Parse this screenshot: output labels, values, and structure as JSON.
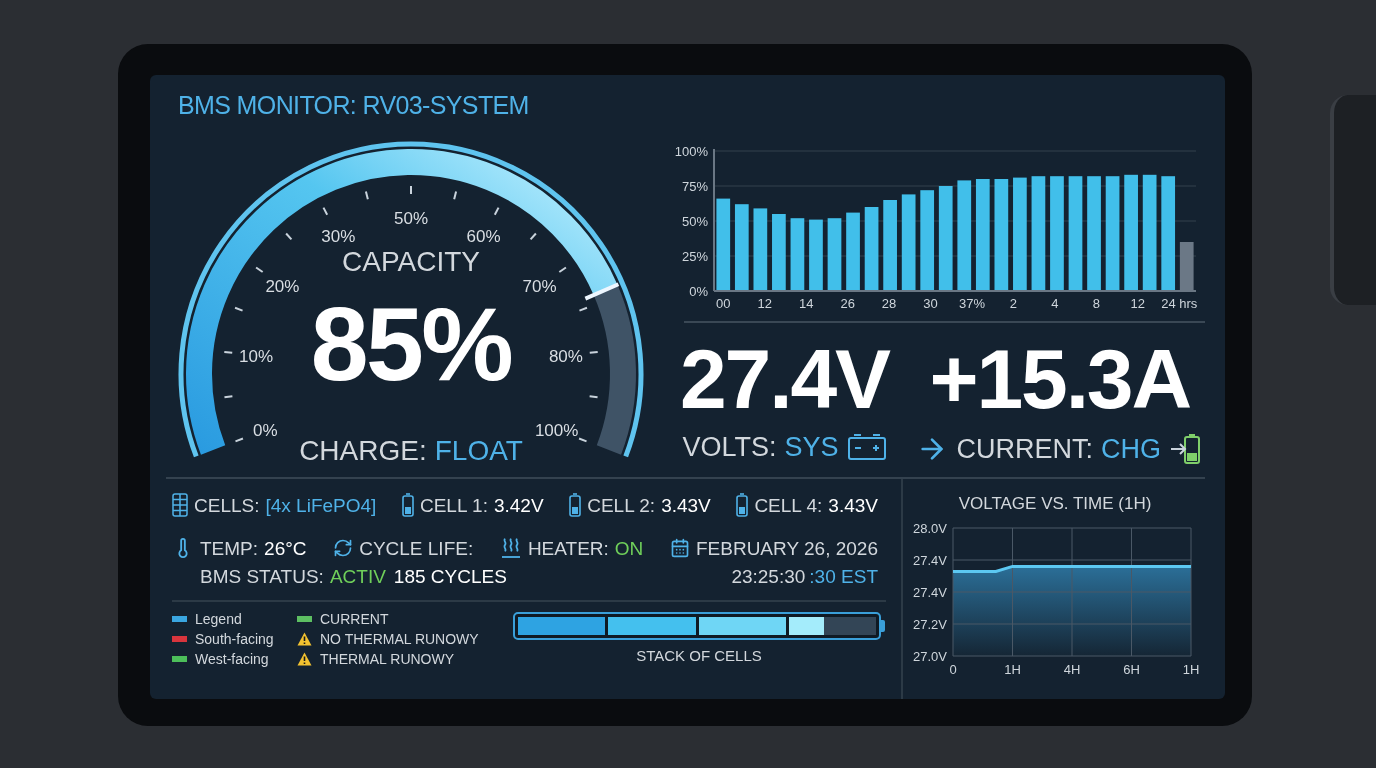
{
  "title": "BMS MONITOR: RV03-SYSTEM",
  "gauge": {
    "heading": "CAPACITY",
    "value": "85%",
    "ticks": [
      "0%",
      "10%",
      "20%",
      "30%",
      "50%",
      "60%",
      "70%",
      "80%",
      "100%"
    ],
    "status_label": "CHARGE:",
    "status_value": "FLOAT"
  },
  "history": {
    "chart_data": {
      "type": "bar",
      "stacked": true,
      "grid": true,
      "series": [
        {
          "color": "#41bfea",
          "values": [
            66,
            62,
            59,
            55,
            52,
            51,
            52,
            56,
            60,
            65,
            69,
            72,
            75,
            79,
            80,
            80,
            81,
            82,
            82,
            82,
            82,
            82,
            83,
            83,
            82,
            null
          ]
        },
        {
          "color": "#6b7886",
          "values": [
            null,
            null,
            null,
            null,
            null,
            null,
            null,
            null,
            null,
            null,
            null,
            null,
            null,
            null,
            null,
            null,
            null,
            null,
            null,
            null,
            null,
            null,
            null,
            null,
            null,
            35
          ]
        }
      ],
      "ylim": [
        0,
        100
      ],
      "yticks": [
        {
          "value": 0,
          "label": "0%"
        },
        {
          "value": 25,
          "label": "25%"
        },
        {
          "value": 50,
          "label": "50%"
        },
        {
          "value": 75,
          "label": "75%"
        },
        {
          "value": 100,
          "label": "100%"
        }
      ]
    },
    "axis_labels": [
      "00",
      "12",
      "14",
      "26",
      "28",
      "30",
      "37%",
      "2",
      "4",
      "8",
      "12",
      "24 hrs"
    ]
  },
  "readouts": [
    {
      "kind": "volts",
      "value": "27.4V",
      "label": "VOLTS:",
      "mode": "SYS"
    },
    {
      "kind": "current",
      "value": "+15.3A",
      "label": "CURRENT:",
      "mode": "CHG"
    }
  ],
  "cells_row": [
    {
      "kind": "pack",
      "label": "CELLS:",
      "value": "[4x LiFePO4]"
    },
    {
      "kind": "cell",
      "label": "CELL 1:",
      "value": "3.42V"
    },
    {
      "kind": "cell",
      "label": "CELL 2:",
      "value": "3.43V"
    },
    {
      "kind": "cell",
      "label": "CELL 4:",
      "value": "3.43V"
    }
  ],
  "status_row": [
    {
      "kind": "temp",
      "label": "TEMP:",
      "value": "26°C"
    },
    {
      "kind": "cycle",
      "label": "CYCLE LIFE:"
    },
    {
      "kind": "heater",
      "label": "HEATER:",
      "value": "ON"
    },
    {
      "kind": "date",
      "label": "FEBRUARY 26, 2026"
    }
  ],
  "bms_status": {
    "label": "BMS STATUS:",
    "value": "ACTIV"
  },
  "cycles": "185 CYCLES",
  "time": {
    "main": "23:25:30",
    "suffix": ":30 EST"
  },
  "legend": [
    {
      "kind": "swatch",
      "label": "Legend",
      "color": "#3aa6e0"
    },
    {
      "kind": "swatch",
      "label": "South-facing",
      "color": "#d8353d"
    },
    {
      "kind": "swatch",
      "label": "West-facing",
      "color": "#4cbf5a"
    },
    {
      "kind": "swatch",
      "label": "CURRENT",
      "color": "#5dbf62"
    },
    {
      "kind": "warning",
      "label": "NO THERMAL RUNOWY"
    },
    {
      "kind": "warning",
      "label": "THERMAL RUNOWY"
    }
  ],
  "stack": {
    "label": "STACK OF CELLS",
    "segments": [
      {
        "level": 1
      },
      {
        "level": 1
      },
      {
        "level": 1
      },
      {
        "level": 0.4
      }
    ]
  },
  "voltage": {
    "title": "VOLTAGE VS. TIME (1H)",
    "y_labels": [
      "28.0V",
      "27.4V",
      "27.4V",
      "27.2V",
      "27.0V"
    ],
    "x_labels": [
      "0",
      "1H",
      "4H",
      "6H",
      "1H"
    ]
  }
}
